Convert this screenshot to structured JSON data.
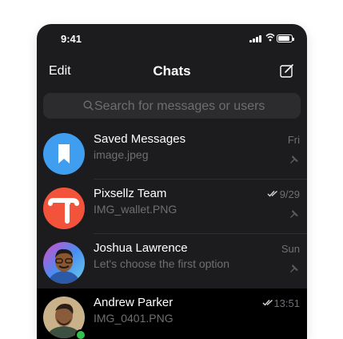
{
  "status_bar": {
    "time": "9:41"
  },
  "nav": {
    "edit_label": "Edit",
    "title": "Chats",
    "compose_icon": "compose-icon"
  },
  "search": {
    "placeholder": "Search for messages or users"
  },
  "chats": [
    {
      "name": "Saved Messages",
      "message": "image.jpeg",
      "date": "Fri",
      "read_checks": false,
      "pinned": true,
      "avatar_icon": "bookmark-icon",
      "avatar_color": "#3f9ef0"
    },
    {
      "name": "Pixsellz Team",
      "message": "IMG_wallet.PNG",
      "date": "9/29",
      "read_checks": true,
      "pinned": true,
      "avatar_icon": "pixsellz-logo",
      "avatar_color": "#f2533a"
    },
    {
      "name": "Joshua Lawrence",
      "message": "Let's choose the first option",
      "date": "Sun",
      "read_checks": false,
      "pinned": true,
      "avatar_icon": "user-photo"
    },
    {
      "name": "Andrew Parker",
      "message": "IMG_0401.PNG",
      "date": "13:51",
      "read_checks": true,
      "pinned": false,
      "online": true,
      "avatar_icon": "user-photo"
    }
  ],
  "colors": {
    "background": "#1c1c1e",
    "accent_blue": "#3f9ef0",
    "secondary_text": "#6f6f74",
    "online": "#31c24b"
  }
}
